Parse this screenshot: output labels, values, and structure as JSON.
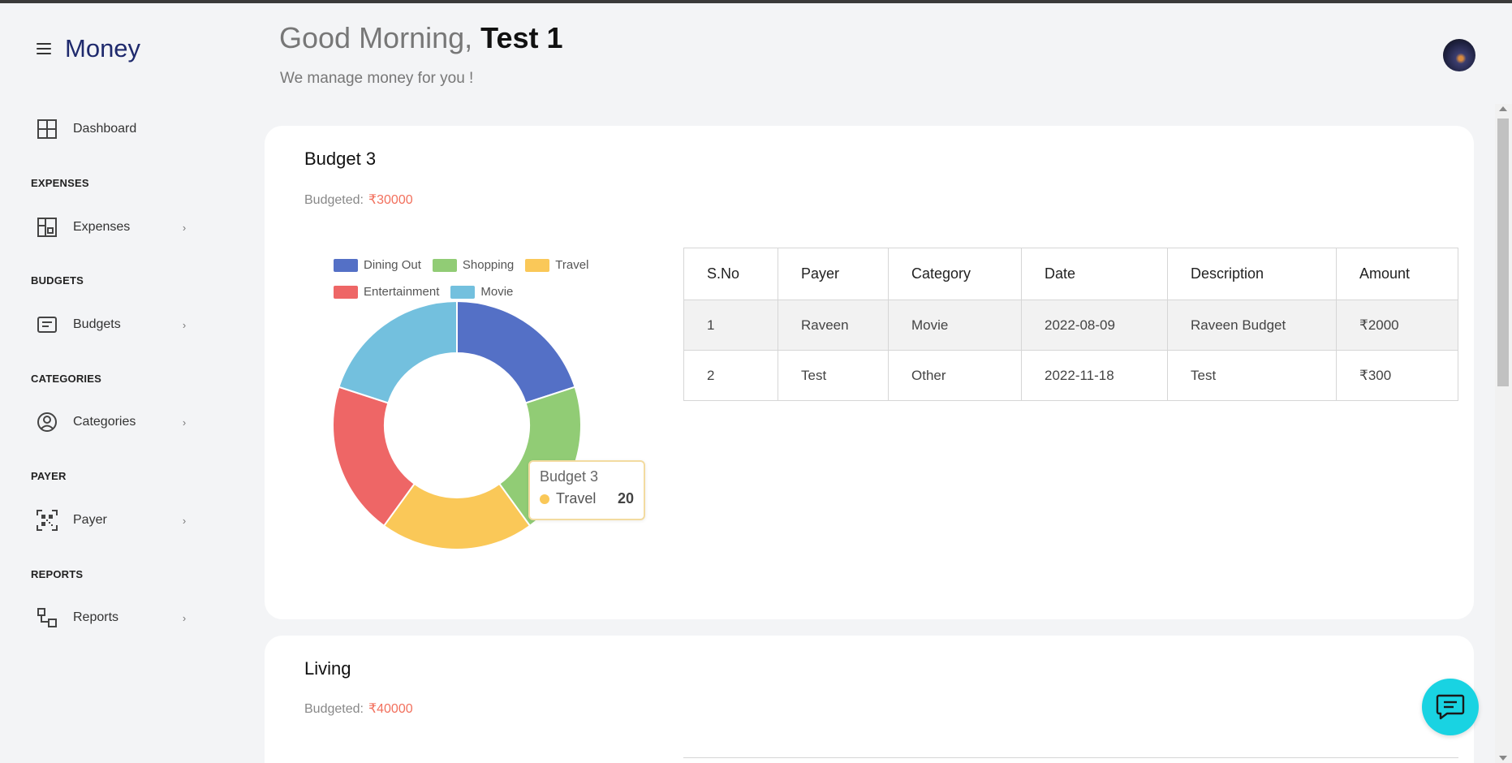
{
  "brand": {
    "name": "Money"
  },
  "sidebar": {
    "dashboard": {
      "label": "Dashboard"
    },
    "sections": [
      {
        "title": "EXPENSES",
        "item": "Expenses"
      },
      {
        "title": "BUDGETS",
        "item": "Budgets"
      },
      {
        "title": "CATEGORIES",
        "item": "Categories"
      },
      {
        "title": "PAYER",
        "item": "Payer"
      },
      {
        "title": "REPORTS",
        "item": "Reports"
      }
    ],
    "chevron": "›"
  },
  "header": {
    "greeting_prefix": "Good Morning,",
    "user_name": "Test 1",
    "subtitle": "We manage money for you !"
  },
  "budgets": [
    {
      "title": "Budget 3",
      "budgeted_label": "Budgeted:",
      "budgeted_amount": "₹30000",
      "table": {
        "headers": [
          "S.No",
          "Payer",
          "Category",
          "Date",
          "Description",
          "Amount"
        ],
        "rows": [
          [
            "1",
            "Raveen",
            "Movie",
            "2022-08-09",
            "Raveen Budget",
            "₹2000"
          ],
          [
            "2",
            "Test",
            "Other",
            "2022-11-18",
            "Test",
            "₹300"
          ]
        ]
      },
      "tooltip": {
        "title": "Budget 3",
        "label": "Travel",
        "value": "20"
      }
    },
    {
      "title": "Living",
      "budgeted_label": "Budgeted:",
      "budgeted_amount": "₹40000"
    }
  ],
  "chart_data": {
    "type": "pie",
    "donut": true,
    "title": "",
    "legend_position": "top",
    "categories": [
      "Dining Out",
      "Shopping",
      "Travel",
      "Entertainment",
      "Movie"
    ],
    "values": [
      20,
      20,
      20,
      20,
      20
    ],
    "colors": [
      "#5470c6",
      "#91cc75",
      "#fac858",
      "#ee6666",
      "#73c0de"
    ]
  },
  "colors": {
    "accent": "#1f2a6d",
    "budget_amount": "#f2705d",
    "chat_fab": "#19d3e2"
  }
}
